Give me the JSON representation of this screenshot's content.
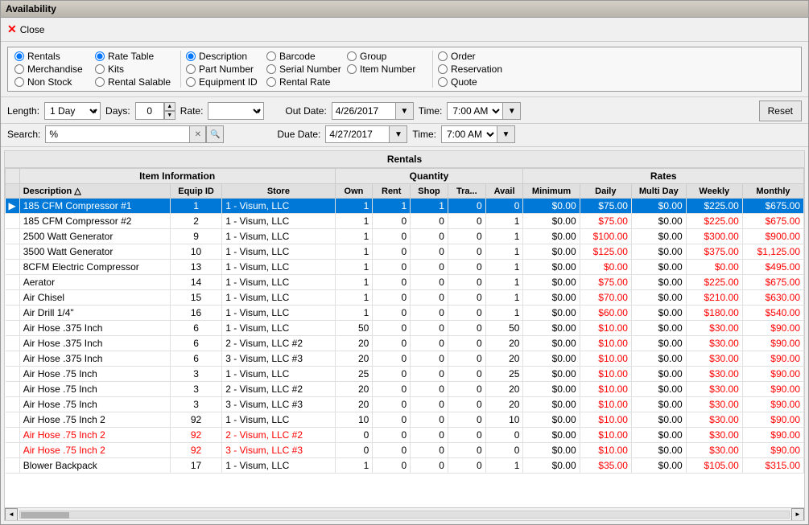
{
  "window": {
    "title": "Availability"
  },
  "toolbar": {
    "close_label": "Close"
  },
  "options": {
    "col1": [
      {
        "label": "Rentals",
        "checked": true
      },
      {
        "label": "Merchandise",
        "checked": false
      },
      {
        "label": "Non Stock",
        "checked": false
      }
    ],
    "col2": [
      {
        "label": "Rate Table",
        "checked": true
      },
      {
        "label": "Kits",
        "checked": false
      },
      {
        "label": "Rental Salable",
        "checked": false
      }
    ],
    "col3": [
      {
        "label": "Description",
        "checked": true
      },
      {
        "label": "Part Number",
        "checked": false
      },
      {
        "label": "Equipment ID",
        "checked": false
      }
    ],
    "col4": [
      {
        "label": "Barcode",
        "checked": false
      },
      {
        "label": "Serial Number",
        "checked": false
      },
      {
        "label": "Rental Rate",
        "checked": false
      }
    ],
    "col5": [
      {
        "label": "Group",
        "checked": false
      },
      {
        "label": "Item Number",
        "checked": false
      }
    ],
    "col6": [
      {
        "label": "Order",
        "checked": false
      },
      {
        "label": "Reservation",
        "checked": false
      },
      {
        "label": "Quote",
        "checked": false
      }
    ]
  },
  "params": {
    "length_label": "Length:",
    "length_value": "1 Day",
    "days_label": "Days:",
    "days_value": "0",
    "rate_label": "Rate:",
    "out_date_label": "Out Date:",
    "out_date_value": "4/26/2017",
    "out_time_label": "Time:",
    "out_time_value": "7:00 AM",
    "due_date_label": "Due Date:",
    "due_date_value": "4/27/2017",
    "due_time_label": "Time:",
    "due_time_value": "7:00 AM",
    "reset_label": "Reset",
    "search_label": "Search:",
    "search_value": "%"
  },
  "table": {
    "title": "Rentals",
    "group_headers": [
      {
        "label": "Item Information",
        "colspan": 3
      },
      {
        "label": "Quantity",
        "colspan": 5
      },
      {
        "label": "Rates",
        "colspan": 6
      }
    ],
    "col_headers": [
      {
        "label": "Description",
        "sort": true
      },
      {
        "label": "Equip ID"
      },
      {
        "label": "Store"
      },
      {
        "label": "Own"
      },
      {
        "label": "Rent"
      },
      {
        "label": "Shop"
      },
      {
        "label": "Tra..."
      },
      {
        "label": "Avail"
      },
      {
        "label": "Minimum"
      },
      {
        "label": "Daily"
      },
      {
        "label": "Multi Day"
      },
      {
        "label": "Weekly"
      },
      {
        "label": "Monthly"
      }
    ],
    "rows": [
      {
        "selected": true,
        "red": false,
        "indicator": "▶",
        "desc": "185 CFM Compressor #1",
        "equip": "1",
        "store": "1 - Visum, LLC",
        "own": "1",
        "rent": "1",
        "shop": "1",
        "tra": "0",
        "avail": "0",
        "min": "$0.00",
        "daily": "$75.00",
        "multi": "$0.00",
        "weekly": "$225.00",
        "monthly": "$675.00"
      },
      {
        "selected": false,
        "red": false,
        "indicator": "",
        "desc": "185 CFM Compressor #2",
        "equip": "2",
        "store": "1 - Visum, LLC",
        "own": "1",
        "rent": "0",
        "shop": "0",
        "tra": "0",
        "avail": "1",
        "min": "$0.00",
        "daily": "$75.00",
        "multi": "$0.00",
        "weekly": "$225.00",
        "monthly": "$675.00"
      },
      {
        "selected": false,
        "red": false,
        "indicator": "",
        "desc": "2500 Watt Generator",
        "equip": "9",
        "store": "1 - Visum, LLC",
        "own": "1",
        "rent": "0",
        "shop": "0",
        "tra": "0",
        "avail": "1",
        "min": "$0.00",
        "daily": "$100.00",
        "multi": "$0.00",
        "weekly": "$300.00",
        "monthly": "$900.00"
      },
      {
        "selected": false,
        "red": false,
        "indicator": "",
        "desc": "3500 Watt Generator",
        "equip": "10",
        "store": "1 - Visum, LLC",
        "own": "1",
        "rent": "0",
        "shop": "0",
        "tra": "0",
        "avail": "1",
        "min": "$0.00",
        "daily": "$125.00",
        "multi": "$0.00",
        "weekly": "$375.00",
        "monthly": "$1,125.00"
      },
      {
        "selected": false,
        "red": false,
        "indicator": "",
        "desc": "8CFM Electric Compressor",
        "equip": "13",
        "store": "1 - Visum, LLC",
        "own": "1",
        "rent": "0",
        "shop": "0",
        "tra": "0",
        "avail": "1",
        "min": "$0.00",
        "daily": "$0.00",
        "multi": "$0.00",
        "weekly": "$0.00",
        "monthly": "$495.00"
      },
      {
        "selected": false,
        "red": false,
        "indicator": "",
        "desc": "Aerator",
        "equip": "14",
        "store": "1 - Visum, LLC",
        "own": "1",
        "rent": "0",
        "shop": "0",
        "tra": "0",
        "avail": "1",
        "min": "$0.00",
        "daily": "$75.00",
        "multi": "$0.00",
        "weekly": "$225.00",
        "monthly": "$675.00"
      },
      {
        "selected": false,
        "red": false,
        "indicator": "",
        "desc": "Air Chisel",
        "equip": "15",
        "store": "1 - Visum, LLC",
        "own": "1",
        "rent": "0",
        "shop": "0",
        "tra": "0",
        "avail": "1",
        "min": "$0.00",
        "daily": "$70.00",
        "multi": "$0.00",
        "weekly": "$210.00",
        "monthly": "$630.00"
      },
      {
        "selected": false,
        "red": false,
        "indicator": "",
        "desc": "Air Drill 1/4\"",
        "equip": "16",
        "store": "1 - Visum, LLC",
        "own": "1",
        "rent": "0",
        "shop": "0",
        "tra": "0",
        "avail": "1",
        "min": "$0.00",
        "daily": "$60.00",
        "multi": "$0.00",
        "weekly": "$180.00",
        "monthly": "$540.00"
      },
      {
        "selected": false,
        "red": false,
        "indicator": "",
        "desc": "Air Hose .375 Inch",
        "equip": "6",
        "store": "1 - Visum, LLC",
        "own": "50",
        "rent": "0",
        "shop": "0",
        "tra": "0",
        "avail": "50",
        "min": "$0.00",
        "daily": "$10.00",
        "multi": "$0.00",
        "weekly": "$30.00",
        "monthly": "$90.00"
      },
      {
        "selected": false,
        "red": false,
        "indicator": "",
        "desc": "Air Hose .375 Inch",
        "equip": "6",
        "store": "2 - Visum, LLC #2",
        "own": "20",
        "rent": "0",
        "shop": "0",
        "tra": "0",
        "avail": "20",
        "min": "$0.00",
        "daily": "$10.00",
        "multi": "$0.00",
        "weekly": "$30.00",
        "monthly": "$90.00"
      },
      {
        "selected": false,
        "red": false,
        "indicator": "",
        "desc": "Air Hose .375 Inch",
        "equip": "6",
        "store": "3 - Visum, LLC #3",
        "own": "20",
        "rent": "0",
        "shop": "0",
        "tra": "0",
        "avail": "20",
        "min": "$0.00",
        "daily": "$10.00",
        "multi": "$0.00",
        "weekly": "$30.00",
        "monthly": "$90.00"
      },
      {
        "selected": false,
        "red": false,
        "indicator": "",
        "desc": "Air Hose .75 Inch",
        "equip": "3",
        "store": "1 - Visum, LLC",
        "own": "25",
        "rent": "0",
        "shop": "0",
        "tra": "0",
        "avail": "25",
        "min": "$0.00",
        "daily": "$10.00",
        "multi": "$0.00",
        "weekly": "$30.00",
        "monthly": "$90.00"
      },
      {
        "selected": false,
        "red": false,
        "indicator": "",
        "desc": "Air Hose .75 Inch",
        "equip": "3",
        "store": "2 - Visum, LLC #2",
        "own": "20",
        "rent": "0",
        "shop": "0",
        "tra": "0",
        "avail": "20",
        "min": "$0.00",
        "daily": "$10.00",
        "multi": "$0.00",
        "weekly": "$30.00",
        "monthly": "$90.00"
      },
      {
        "selected": false,
        "red": false,
        "indicator": "",
        "desc": "Air Hose .75 Inch",
        "equip": "3",
        "store": "3 - Visum, LLC #3",
        "own": "20",
        "rent": "0",
        "shop": "0",
        "tra": "0",
        "avail": "20",
        "min": "$0.00",
        "daily": "$10.00",
        "multi": "$0.00",
        "weekly": "$30.00",
        "monthly": "$90.00"
      },
      {
        "selected": false,
        "red": false,
        "indicator": "",
        "desc": "Air Hose .75 Inch 2",
        "equip": "92",
        "store": "1 - Visum, LLC",
        "own": "10",
        "rent": "0",
        "shop": "0",
        "tra": "0",
        "avail": "10",
        "min": "$0.00",
        "daily": "$10.00",
        "multi": "$0.00",
        "weekly": "$30.00",
        "monthly": "$90.00"
      },
      {
        "selected": false,
        "red": true,
        "indicator": "",
        "desc": "Air Hose .75 Inch 2",
        "equip": "92",
        "store": "2 - Visum, LLC #2",
        "own": "0",
        "rent": "0",
        "shop": "0",
        "tra": "0",
        "avail": "0",
        "min": "$0.00",
        "daily": "$10.00",
        "multi": "$0.00",
        "weekly": "$30.00",
        "monthly": "$90.00"
      },
      {
        "selected": false,
        "red": true,
        "indicator": "",
        "desc": "Air Hose .75 Inch 2",
        "equip": "92",
        "store": "3 - Visum, LLC #3",
        "own": "0",
        "rent": "0",
        "shop": "0",
        "tra": "0",
        "avail": "0",
        "min": "$0.00",
        "daily": "$10.00",
        "multi": "$0.00",
        "weekly": "$30.00",
        "monthly": "$90.00"
      },
      {
        "selected": false,
        "red": false,
        "indicator": "",
        "desc": "Blower Backpack",
        "equip": "17",
        "store": "1 - Visum, LLC",
        "own": "1",
        "rent": "0",
        "shop": "0",
        "tra": "0",
        "avail": "1",
        "min": "$0.00",
        "daily": "$35.00",
        "multi": "$0.00",
        "weekly": "$105.00",
        "monthly": "$315.00"
      }
    ]
  },
  "scrollbar": {
    "left_arrow": "◄",
    "right_arrow": "►"
  }
}
